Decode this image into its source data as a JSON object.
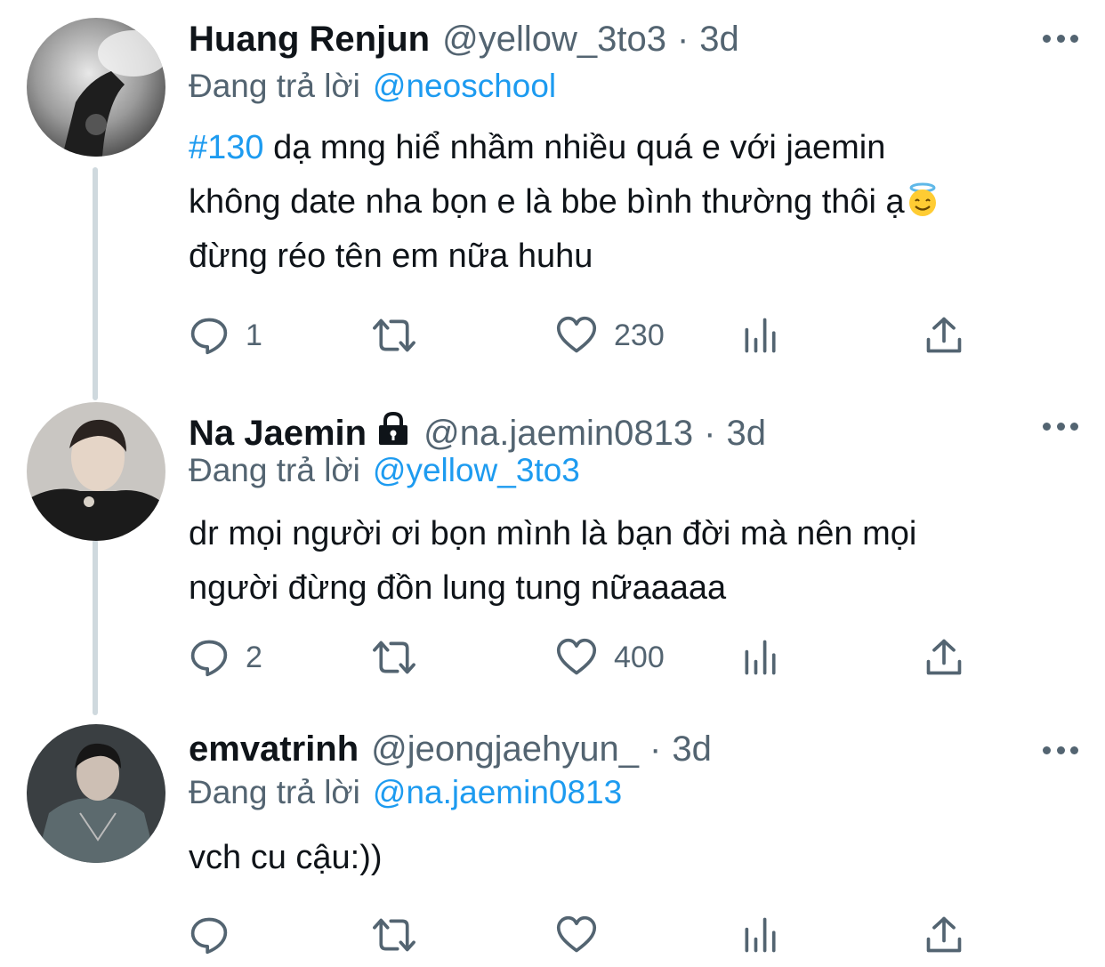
{
  "tweets": [
    {
      "name": "Huang Renjun",
      "handle": "@yellow_3to3",
      "time": "3d",
      "replying_prefix": "Đang trả lời",
      "replying_to": "@neoschool",
      "hashtag": "#130",
      "line1": "dạ mng hiể nhầm nhiều quá e với jaemin",
      "line2": "không date nha bọn e là bbe bình thường thôi ạ",
      "line3": "đừng réo tên em nữa huhu",
      "emoji": "smiling-face-with-halo",
      "replies": "1",
      "likes": "230"
    },
    {
      "name": "Na Jaemin",
      "handle": "@na.jaemin0813",
      "time": "3d",
      "protected": true,
      "replying_prefix": "Đang trả lời",
      "replying_to": "@yellow_3to3",
      "line1": "dr mọi người ơi bọn mình là bạn đời mà nên mọi",
      "line2": "người đừng đồn lung tung nữaaaaa",
      "replies": "2",
      "likes": "400"
    },
    {
      "name": "emvatrinh",
      "handle": "@jeongjaehyun_",
      "time": "3d",
      "replying_prefix": "Đang trả lời",
      "replying_to": "@na.jaemin0813",
      "line1": "vch cu cậu:))"
    }
  ],
  "separator": "·",
  "colors": {
    "link": "#1d9bf0",
    "secondary": "#536471",
    "text": "#0f1419",
    "thread_line": "#cfd9de"
  },
  "icons": [
    "reply-icon",
    "retweet-icon",
    "like-icon",
    "views-icon",
    "share-icon",
    "more-icon",
    "lock-icon"
  ]
}
